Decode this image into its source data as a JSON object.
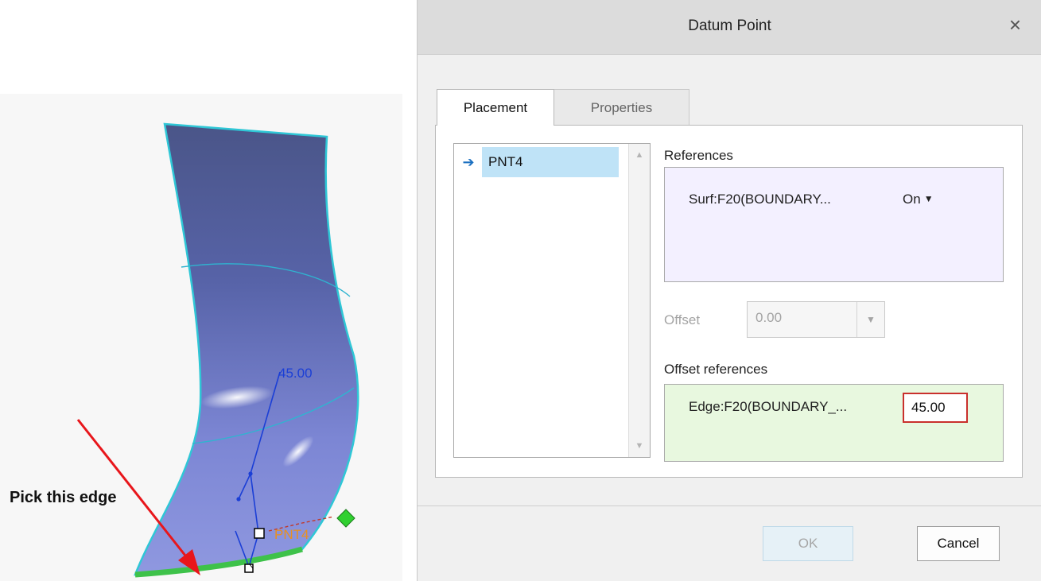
{
  "viewport": {
    "callout_text": "Pick this edge",
    "dimension_label": "45.00",
    "point_label": "PNT4",
    "colors": {
      "surface": "#6e78c8",
      "edge_highlight": "#3ec24a",
      "dimension": "#1b3fd6",
      "arrow": "#e8161b",
      "datum_marker": "#30d030"
    }
  },
  "dialog": {
    "title": "Datum Point",
    "close_glyph": "×",
    "tabs": [
      {
        "label": "Placement",
        "active": true
      },
      {
        "label": "Properties",
        "active": false
      }
    ],
    "point_list": {
      "items": [
        {
          "label": "PNT4",
          "selected": true,
          "icon": "right-arrow-icon"
        }
      ]
    },
    "references": {
      "label": "References",
      "entry": "Surf:F20(BOUNDARY...",
      "type": "On",
      "type_glyph": "▼"
    },
    "offset": {
      "label": "Offset",
      "value": "0.00",
      "enabled": false,
      "dropdown_glyph": "▼"
    },
    "offset_references": {
      "label": "Offset references",
      "entry": "Edge:F20(BOUNDARY_...",
      "value": "45.00"
    },
    "buttons": {
      "ok": "OK",
      "cancel": "Cancel"
    }
  }
}
